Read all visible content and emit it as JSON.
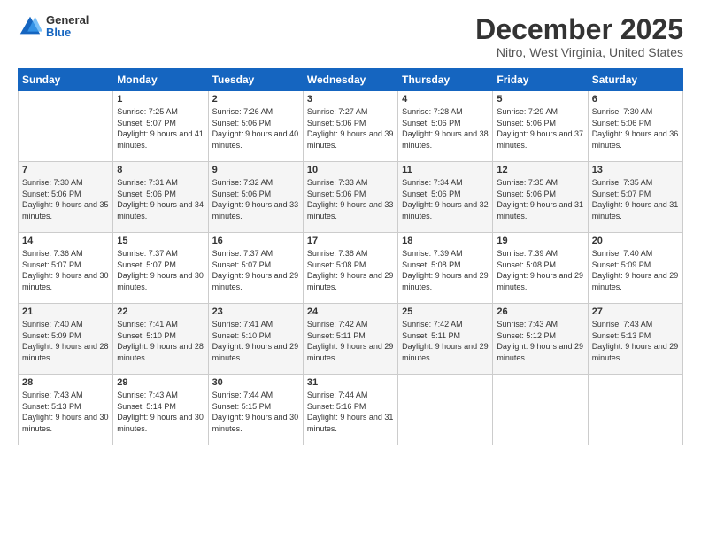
{
  "logo": {
    "general": "General",
    "blue": "Blue"
  },
  "header": {
    "month_title": "December 2025",
    "location": "Nitro, West Virginia, United States"
  },
  "weekdays": [
    "Sunday",
    "Monday",
    "Tuesday",
    "Wednesday",
    "Thursday",
    "Friday",
    "Saturday"
  ],
  "weeks": [
    [
      {
        "day": "",
        "sunrise": "",
        "sunset": "",
        "daylight": ""
      },
      {
        "day": "1",
        "sunrise": "Sunrise: 7:25 AM",
        "sunset": "Sunset: 5:07 PM",
        "daylight": "Daylight: 9 hours and 41 minutes."
      },
      {
        "day": "2",
        "sunrise": "Sunrise: 7:26 AM",
        "sunset": "Sunset: 5:06 PM",
        "daylight": "Daylight: 9 hours and 40 minutes."
      },
      {
        "day": "3",
        "sunrise": "Sunrise: 7:27 AM",
        "sunset": "Sunset: 5:06 PM",
        "daylight": "Daylight: 9 hours and 39 minutes."
      },
      {
        "day": "4",
        "sunrise": "Sunrise: 7:28 AM",
        "sunset": "Sunset: 5:06 PM",
        "daylight": "Daylight: 9 hours and 38 minutes."
      },
      {
        "day": "5",
        "sunrise": "Sunrise: 7:29 AM",
        "sunset": "Sunset: 5:06 PM",
        "daylight": "Daylight: 9 hours and 37 minutes."
      },
      {
        "day": "6",
        "sunrise": "Sunrise: 7:30 AM",
        "sunset": "Sunset: 5:06 PM",
        "daylight": "Daylight: 9 hours and 36 minutes."
      }
    ],
    [
      {
        "day": "7",
        "sunrise": "Sunrise: 7:30 AM",
        "sunset": "Sunset: 5:06 PM",
        "daylight": "Daylight: 9 hours and 35 minutes."
      },
      {
        "day": "8",
        "sunrise": "Sunrise: 7:31 AM",
        "sunset": "Sunset: 5:06 PM",
        "daylight": "Daylight: 9 hours and 34 minutes."
      },
      {
        "day": "9",
        "sunrise": "Sunrise: 7:32 AM",
        "sunset": "Sunset: 5:06 PM",
        "daylight": "Daylight: 9 hours and 33 minutes."
      },
      {
        "day": "10",
        "sunrise": "Sunrise: 7:33 AM",
        "sunset": "Sunset: 5:06 PM",
        "daylight": "Daylight: 9 hours and 33 minutes."
      },
      {
        "day": "11",
        "sunrise": "Sunrise: 7:34 AM",
        "sunset": "Sunset: 5:06 PM",
        "daylight": "Daylight: 9 hours and 32 minutes."
      },
      {
        "day": "12",
        "sunrise": "Sunrise: 7:35 AM",
        "sunset": "Sunset: 5:06 PM",
        "daylight": "Daylight: 9 hours and 31 minutes."
      },
      {
        "day": "13",
        "sunrise": "Sunrise: 7:35 AM",
        "sunset": "Sunset: 5:07 PM",
        "daylight": "Daylight: 9 hours and 31 minutes."
      }
    ],
    [
      {
        "day": "14",
        "sunrise": "Sunrise: 7:36 AM",
        "sunset": "Sunset: 5:07 PM",
        "daylight": "Daylight: 9 hours and 30 minutes."
      },
      {
        "day": "15",
        "sunrise": "Sunrise: 7:37 AM",
        "sunset": "Sunset: 5:07 PM",
        "daylight": "Daylight: 9 hours and 30 minutes."
      },
      {
        "day": "16",
        "sunrise": "Sunrise: 7:37 AM",
        "sunset": "Sunset: 5:07 PM",
        "daylight": "Daylight: 9 hours and 29 minutes."
      },
      {
        "day": "17",
        "sunrise": "Sunrise: 7:38 AM",
        "sunset": "Sunset: 5:08 PM",
        "daylight": "Daylight: 9 hours and 29 minutes."
      },
      {
        "day": "18",
        "sunrise": "Sunrise: 7:39 AM",
        "sunset": "Sunset: 5:08 PM",
        "daylight": "Daylight: 9 hours and 29 minutes."
      },
      {
        "day": "19",
        "sunrise": "Sunrise: 7:39 AM",
        "sunset": "Sunset: 5:08 PM",
        "daylight": "Daylight: 9 hours and 29 minutes."
      },
      {
        "day": "20",
        "sunrise": "Sunrise: 7:40 AM",
        "sunset": "Sunset: 5:09 PM",
        "daylight": "Daylight: 9 hours and 29 minutes."
      }
    ],
    [
      {
        "day": "21",
        "sunrise": "Sunrise: 7:40 AM",
        "sunset": "Sunset: 5:09 PM",
        "daylight": "Daylight: 9 hours and 28 minutes."
      },
      {
        "day": "22",
        "sunrise": "Sunrise: 7:41 AM",
        "sunset": "Sunset: 5:10 PM",
        "daylight": "Daylight: 9 hours and 28 minutes."
      },
      {
        "day": "23",
        "sunrise": "Sunrise: 7:41 AM",
        "sunset": "Sunset: 5:10 PM",
        "daylight": "Daylight: 9 hours and 29 minutes."
      },
      {
        "day": "24",
        "sunrise": "Sunrise: 7:42 AM",
        "sunset": "Sunset: 5:11 PM",
        "daylight": "Daylight: 9 hours and 29 minutes."
      },
      {
        "day": "25",
        "sunrise": "Sunrise: 7:42 AM",
        "sunset": "Sunset: 5:11 PM",
        "daylight": "Daylight: 9 hours and 29 minutes."
      },
      {
        "day": "26",
        "sunrise": "Sunrise: 7:43 AM",
        "sunset": "Sunset: 5:12 PM",
        "daylight": "Daylight: 9 hours and 29 minutes."
      },
      {
        "day": "27",
        "sunrise": "Sunrise: 7:43 AM",
        "sunset": "Sunset: 5:13 PM",
        "daylight": "Daylight: 9 hours and 29 minutes."
      }
    ],
    [
      {
        "day": "28",
        "sunrise": "Sunrise: 7:43 AM",
        "sunset": "Sunset: 5:13 PM",
        "daylight": "Daylight: 9 hours and 30 minutes."
      },
      {
        "day": "29",
        "sunrise": "Sunrise: 7:43 AM",
        "sunset": "Sunset: 5:14 PM",
        "daylight": "Daylight: 9 hours and 30 minutes."
      },
      {
        "day": "30",
        "sunrise": "Sunrise: 7:44 AM",
        "sunset": "Sunset: 5:15 PM",
        "daylight": "Daylight: 9 hours and 30 minutes."
      },
      {
        "day": "31",
        "sunrise": "Sunrise: 7:44 AM",
        "sunset": "Sunset: 5:16 PM",
        "daylight": "Daylight: 9 hours and 31 minutes."
      },
      {
        "day": "",
        "sunrise": "",
        "sunset": "",
        "daylight": ""
      },
      {
        "day": "",
        "sunrise": "",
        "sunset": "",
        "daylight": ""
      },
      {
        "day": "",
        "sunrise": "",
        "sunset": "",
        "daylight": ""
      }
    ]
  ]
}
